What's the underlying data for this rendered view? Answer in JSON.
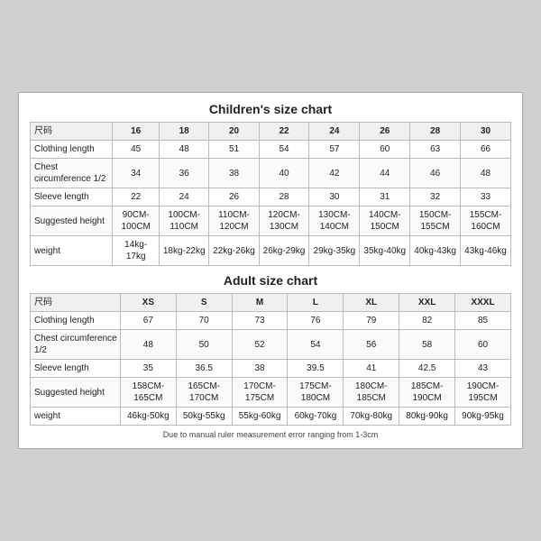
{
  "children_chart": {
    "title": "Children's size chart",
    "columns": [
      "尺码",
      "16",
      "18",
      "20",
      "22",
      "24",
      "26",
      "28",
      "30"
    ],
    "rows": [
      {
        "label": "Clothing length",
        "values": [
          "45",
          "48",
          "51",
          "54",
          "57",
          "60",
          "63",
          "66"
        ]
      },
      {
        "label": "Chest circumference 1/2",
        "values": [
          "34",
          "36",
          "38",
          "40",
          "42",
          "44",
          "46",
          "48"
        ]
      },
      {
        "label": "Sleeve length",
        "values": [
          "22",
          "24",
          "26",
          "28",
          "30",
          "31",
          "32",
          "33"
        ]
      },
      {
        "label": "Suggested height",
        "values": [
          "90CM-100CM",
          "100CM-110CM",
          "110CM-120CM",
          "120CM-130CM",
          "130CM-140CM",
          "140CM-150CM",
          "150CM-155CM",
          "155CM-160CM"
        ]
      },
      {
        "label": "weight",
        "values": [
          "14kg-17kg",
          "18kg-22kg",
          "22kg-26kg",
          "26kg-29kg",
          "29kg-35kg",
          "35kg-40kg",
          "40kg-43kg",
          "43kg-46kg"
        ]
      }
    ]
  },
  "adult_chart": {
    "title": "Adult size chart",
    "columns": [
      "尺码",
      "XS",
      "S",
      "M",
      "L",
      "XL",
      "XXL",
      "XXXL"
    ],
    "rows": [
      {
        "label": "Clothing length",
        "values": [
          "67",
          "70",
          "73",
          "76",
          "79",
          "82",
          "85"
        ]
      },
      {
        "label": "Chest circumference 1/2",
        "values": [
          "48",
          "50",
          "52",
          "54",
          "56",
          "58",
          "60"
        ]
      },
      {
        "label": "Sleeve length",
        "values": [
          "35",
          "36.5",
          "38",
          "39.5",
          "41",
          "42.5",
          "43"
        ]
      },
      {
        "label": "Suggested height",
        "values": [
          "158CM-165CM",
          "165CM-170CM",
          "170CM-175CM",
          "175CM-180CM",
          "180CM-185CM",
          "185CM-190CM",
          "190CM-195CM"
        ]
      },
      {
        "label": "weight",
        "values": [
          "46kg-50kg",
          "50kg-55kg",
          "55kg-60kg",
          "60kg-70kg",
          "70kg-80kg",
          "80kg-90kg",
          "90kg-95kg"
        ]
      }
    ]
  },
  "footer": {
    "note": "Due to manual ruler measurement error ranging from 1-3cm"
  }
}
